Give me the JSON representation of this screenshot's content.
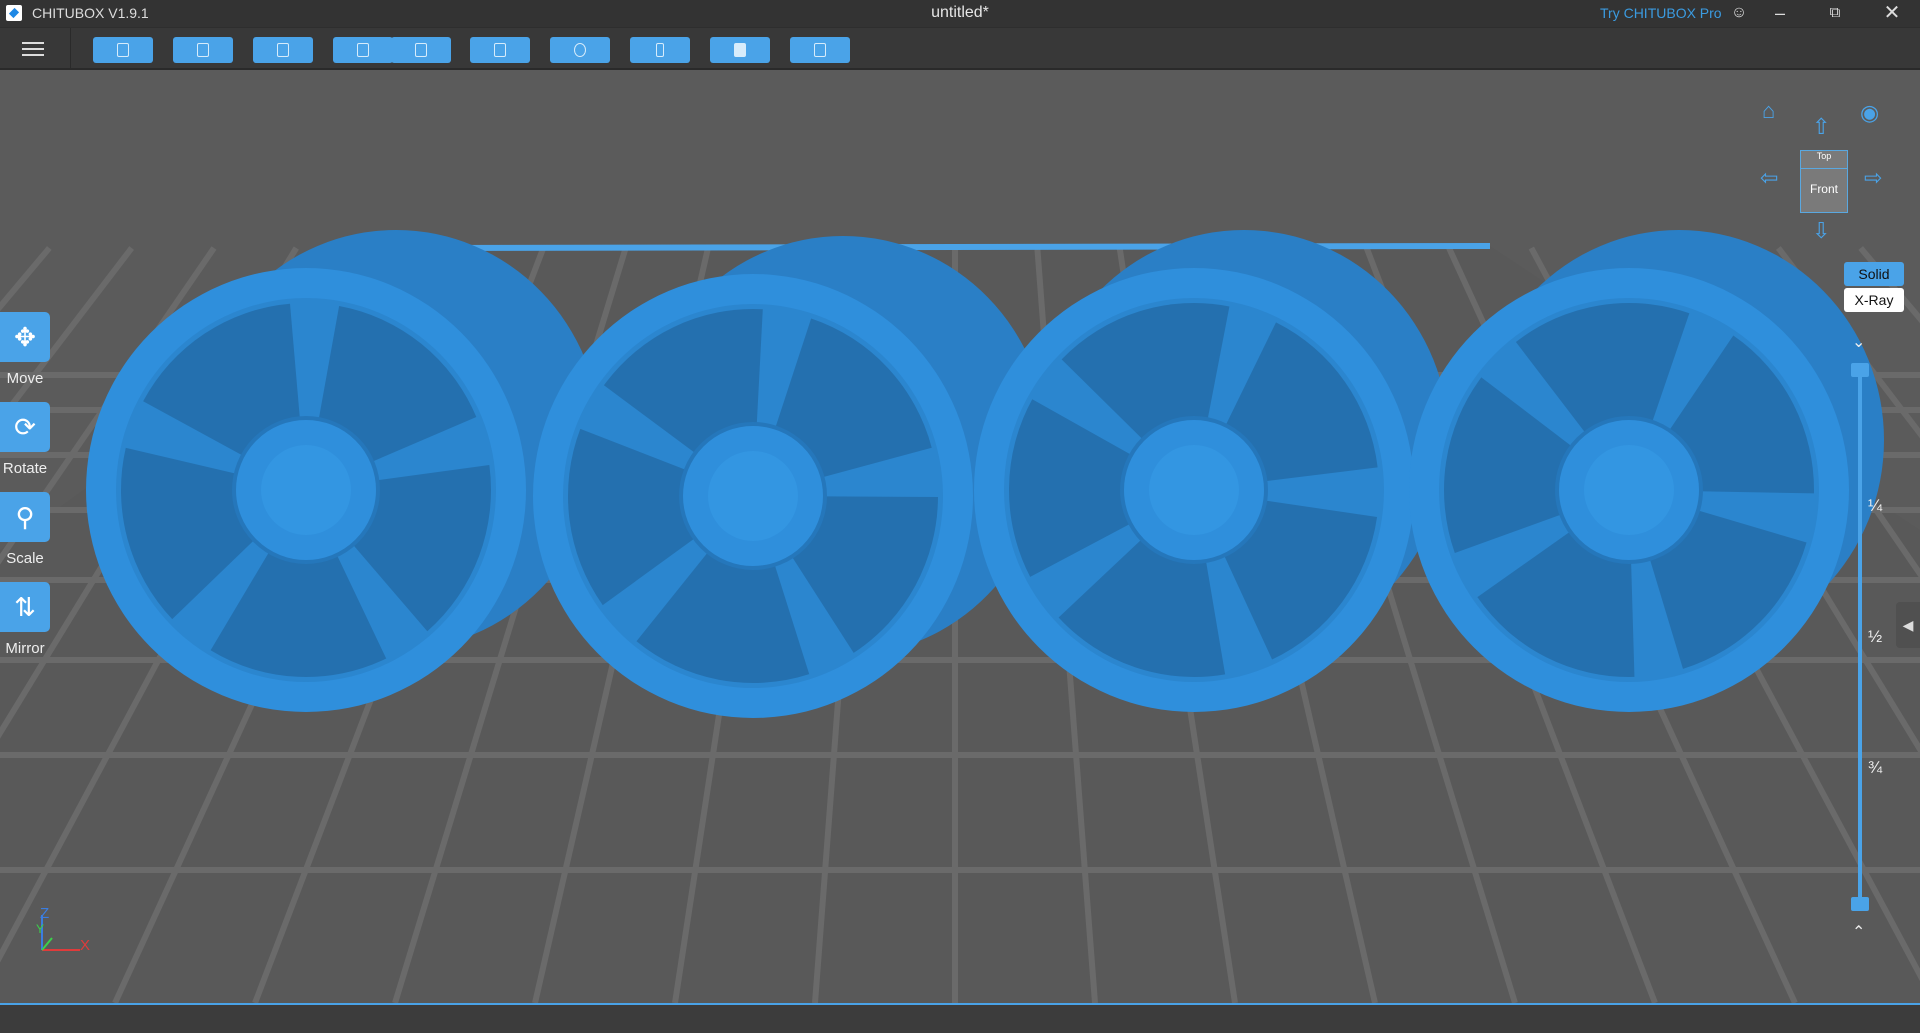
{
  "titlebar": {
    "app_name": "CHITUBOX V1.9.1",
    "document_title": "untitled*",
    "try_pro": "Try CHITUBOX Pro"
  },
  "toolbar": {
    "buttons": [
      "open-file",
      "save",
      "auto-layout",
      "undo",
      "redo",
      "settings",
      "supports",
      "hollow",
      "slice",
      "dig-hole",
      "print"
    ]
  },
  "tools": [
    {
      "label": "Move"
    },
    {
      "label": "Rotate"
    },
    {
      "label": "Scale"
    },
    {
      "label": "Mirror"
    }
  ],
  "view": {
    "cube_top": "Top",
    "cube_front": "Front",
    "solid": "Solid",
    "xray": "X-Ray"
  },
  "slider": {
    "marks": [
      "¼",
      "½",
      "¾"
    ],
    "value": 0
  },
  "axes": {
    "z": "Z",
    "y": "Y",
    "x": "X"
  },
  "colors": {
    "accent": "#4aa3e8",
    "model": "#2f8fdc"
  }
}
